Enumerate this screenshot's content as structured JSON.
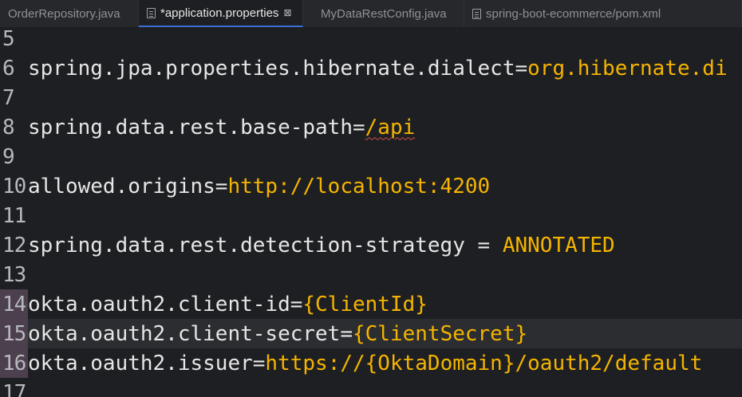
{
  "tabs": [
    {
      "label": "OrderRepository.java",
      "icon": "java-file-icon",
      "active": false
    },
    {
      "label": "*application.properties",
      "icon": "properties-file-icon",
      "active": true,
      "close": "⊠"
    },
    {
      "label": "MyDataRestConfig.java",
      "icon": "java-file-icon",
      "active": false
    },
    {
      "label": "spring-boot-ecommerce/pom.xml",
      "icon": "xml-file-icon",
      "active": false
    }
  ],
  "editor": {
    "current_line": 15,
    "lines": [
      {
        "num": "5",
        "key": "",
        "val": ""
      },
      {
        "num": "6",
        "key": "spring.jpa.properties.hibernate.dialect=",
        "val": "org.hibernate.di"
      },
      {
        "num": "7",
        "key": "",
        "val": ""
      },
      {
        "num": "8",
        "key": "spring.data.rest.base-path=",
        "val": "/api"
      },
      {
        "num": "9",
        "key": "",
        "val": ""
      },
      {
        "num": "10",
        "key": "allowed.origins=",
        "val": "http://localhost:4200"
      },
      {
        "num": "11",
        "key": "",
        "val": ""
      },
      {
        "num": "12",
        "key": "spring.data.rest.detection-strategy = ",
        "val": "ANNOTATED"
      },
      {
        "num": "13",
        "key": "",
        "val": ""
      },
      {
        "num": "14",
        "key": "okta.oauth2.client-id=",
        "val": "{ClientId}"
      },
      {
        "num": "15",
        "key": "okta.oauth2.client-secret=",
        "val": "{ClientSecret}"
      },
      {
        "num": "16",
        "key": "okta.oauth2.issuer=",
        "val": "https://{OktaDomain}/oauth2/default"
      },
      {
        "num": "17",
        "key": "",
        "val": ""
      }
    ]
  },
  "colors": {
    "background": "#1e1f22",
    "key_text": "#e6e6e6",
    "value_text": "#f4b400",
    "current_line": "#2b2d31",
    "marked_gutter": "#4c3f4e"
  }
}
